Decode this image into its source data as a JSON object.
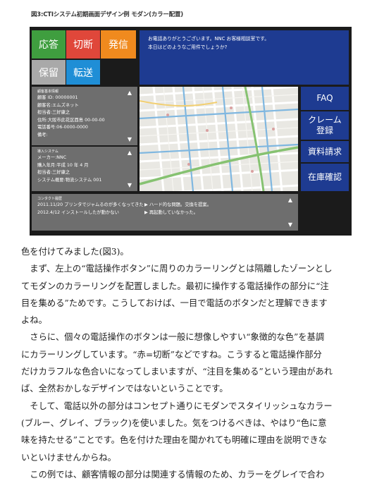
{
  "caption": "図3:CTIシステム初期画面デザイン例 モダン(カラー配置)",
  "phone_buttons": {
    "answer": "応答",
    "cut": "切断",
    "call": "発信",
    "hold": "保留",
    "transfer": "転送"
  },
  "message": {
    "line1": "お電話ありがとうございます。NNC お客様相談室です。",
    "line2": "本日はどのようなご用件でしょうか?"
  },
  "customer_panel": {
    "title": "顧客基本情報",
    "lines": [
      "顧客 ID: 00000001",
      "顧客名:エムズネット",
      "担当者:三好康之",
      "住所:大阪市此花区酉島 00-00-00",
      "電話番号:06-0000-0000",
      "備考:"
    ]
  },
  "system_panel": {
    "title": "導入システム",
    "lines": [
      "メーカー:NNC",
      "購入年月:平成 10 年 4 月",
      "担当者:三好康之",
      "システム概要:物流システム 001"
    ]
  },
  "contact_panel": {
    "title": "コンタクト履歴",
    "rows": [
      {
        "left": "2011.11/20 プリンタでジャムるのが多くなってきた",
        "right": "▶ ハード的な問題。交換を提案。"
      },
      {
        "left": "2012.4/12 インストールしたが動かない",
        "right": "▶ 再起動していなかった。"
      }
    ]
  },
  "side_buttons": {
    "faq": "FAQ",
    "claim_1": "クレーム",
    "claim_2": "登録",
    "request": "資料請求",
    "stock": "在庫確認"
  },
  "colors": {
    "answer": "#3f9e3f",
    "cut": "#e0473a",
    "call": "#f08a1e",
    "hold": "#a9a9a9",
    "transfer": "#1f8ed6",
    "navy": "#1e3b91",
    "gray": "#6e6e6e"
  },
  "body_text": [
    "色を付けてみました(図3)。",
    "　まず、左上の“電話操作ボタン”に周りのカラーリングとは隔離したゾーンとし",
    "てモダンのカラーリングを配置しました。最初に操作する電話操作の部分に“注",
    "目を集める”ためです。こうしておけば、一目で電話のボタンだと理解できます",
    "よね。",
    "　さらに、個々の電話操作のボタンは一般に想像しやすい“象徴的な色”を基調",
    "にカラーリングしています。“赤=切断”などですね。こうすると電話操作部分",
    "だけカラフルな色合いになってしまいますが、“注目を集める”という理由があれ",
    "ば、全然おかしなデザインではないということです。",
    "　そして、電話以外の部分はコンセプト通りにモダンでスタイリッシュなカラー",
    "(ブルー、グレイ、ブラック)を使いました。気をつけるべきは、やはり“色に意",
    "味を持たせる”ことです。色を付けた理由を聞かれても明確に理由を説明できな",
    "いといけませんからね。",
    "　この例では、顧客情報の部分は関連する情報のため、カラーをグレイで合わ"
  ]
}
